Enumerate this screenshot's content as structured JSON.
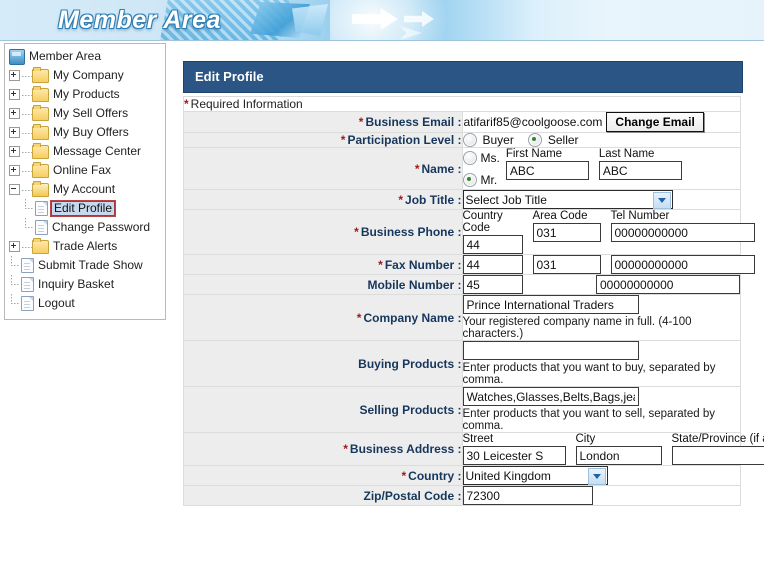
{
  "banner": {
    "title": "Member Area"
  },
  "sidebar": {
    "root": {
      "label": "Member Area",
      "icon": "computer-icon"
    },
    "items": [
      {
        "label": "My Company",
        "icon": "folder-icon",
        "expander": "plus"
      },
      {
        "label": "My Products",
        "icon": "folder-icon",
        "expander": "plus"
      },
      {
        "label": "My Sell Offers",
        "icon": "folder-icon",
        "expander": "plus"
      },
      {
        "label": "My Buy Offers",
        "icon": "folder-icon",
        "expander": "plus"
      },
      {
        "label": "Message Center",
        "icon": "folder-icon",
        "expander": "plus"
      },
      {
        "label": "Online Fax",
        "icon": "folder-icon",
        "expander": "plus"
      },
      {
        "label": "My Account",
        "icon": "folder-open-icon",
        "expander": "minus"
      },
      {
        "label": "Edit Profile",
        "icon": "page-icon",
        "expander": "none",
        "selected": true
      },
      {
        "label": "Change Password",
        "icon": "page-icon",
        "expander": "none"
      },
      {
        "label": "Trade Alerts",
        "icon": "folder-icon",
        "expander": "plus"
      },
      {
        "label": "Submit Trade Show",
        "icon": "page-icon",
        "expander": "none"
      },
      {
        "label": "Inquiry Basket",
        "icon": "page-icon",
        "expander": "none"
      },
      {
        "label": "Logout",
        "icon": "page-icon",
        "expander": "none"
      }
    ]
  },
  "form": {
    "title": "Edit Profile",
    "required_note_star": "*",
    "required_note": "Required Information",
    "rows": {
      "business_email": {
        "label": "Business Email :",
        "value": "atifarif85@coolgoose.com",
        "button": "Change Email"
      },
      "participation_level": {
        "label": "Participation Level :",
        "options": [
          {
            "label": "Buyer",
            "selected": false
          },
          {
            "label": "Seller",
            "selected": true
          }
        ]
      },
      "name": {
        "label": "Name :",
        "titles": [
          {
            "label": "Ms.",
            "selected": false
          },
          {
            "label": "Mr.",
            "selected": true
          }
        ],
        "first_name_label": "First Name",
        "last_name_label": "Last Name",
        "first_name": "ABC",
        "last_name": "ABC"
      },
      "job_title": {
        "label": "Job Title :",
        "selected": "Select Job Title"
      },
      "business_phone": {
        "label": "Business Phone :",
        "country_code_label": "Country Code",
        "area_code_label": "Area Code",
        "tel_label": "Tel Number",
        "country_code": "44",
        "area_code": "031",
        "tel": "00000000000"
      },
      "fax_number": {
        "label": "Fax Number :",
        "country_code": "44",
        "area_code": "031",
        "tel": "00000000000"
      },
      "mobile_number": {
        "label": "Mobile Number :",
        "country_code": "45",
        "area_code": "",
        "tel": "00000000000"
      },
      "company_name": {
        "label": "Company Name :",
        "value": "Prince International Traders",
        "hint": "Your registered company name in full. (4-100 characters.)"
      },
      "buying_products": {
        "label": "Buying Products :",
        "value": "",
        "hint": "Enter products that you want to buy, separated by comma."
      },
      "selling_products": {
        "label": "Selling Products :",
        "value": "Watches,Glasses,Belts,Bags,jeans",
        "hint": "Enter products that you want to sell, separated by comma."
      },
      "business_address": {
        "label": "Business Address :",
        "street_label": "Street",
        "city_label": "City",
        "state_label": "State/Province (if any)",
        "street": "30 Leicester S",
        "city": "London",
        "state": ""
      },
      "country": {
        "label": "Country :",
        "selected": "United Kingdom"
      },
      "zip_postal_code": {
        "label": "Zip/Postal Code :",
        "value": "72300"
      }
    }
  },
  "colors": {
    "header_bar": "#2a5585",
    "label_text": "#16365c",
    "required_star": "#a01a1a",
    "label_bg": "#ededed",
    "banner_blue": "#7ec4ea",
    "selected_item_bg": "#c6d9ef",
    "selected_item_border": "#a33b3b",
    "radio_dot": "#2e8b2e"
  }
}
